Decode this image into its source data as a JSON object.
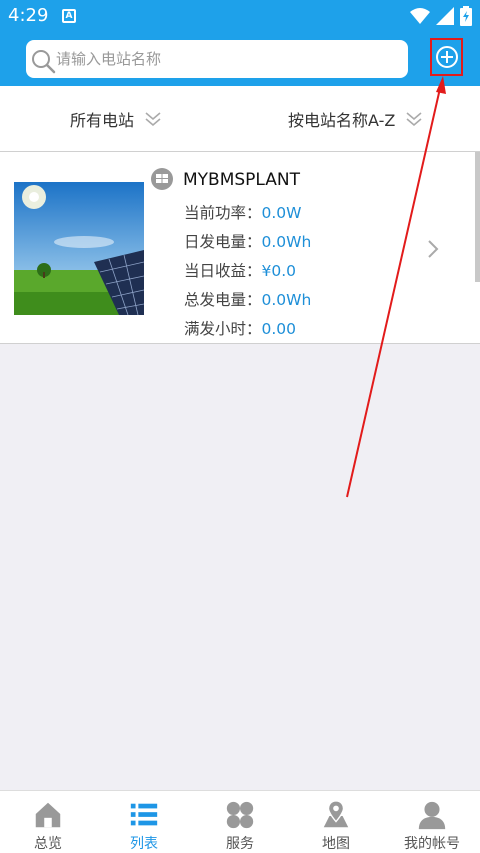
{
  "status": {
    "time": "4:29",
    "a_badge": "A"
  },
  "search": {
    "placeholder": "请输入电站名称",
    "value": ""
  },
  "filters": {
    "all_label": "所有电站",
    "sort_label": "按电站名称A-Z"
  },
  "plant": {
    "name": "MYBMSPLANT",
    "metrics": [
      {
        "label": "当前功率：",
        "value": "0.0W"
      },
      {
        "label": "日发电量：",
        "value": "0.0Wh"
      },
      {
        "label": "当日收益：",
        "value": "¥0.0"
      },
      {
        "label": "总发电量：",
        "value": "0.0Wh"
      },
      {
        "label": "满发小时：",
        "value": "0.00"
      }
    ]
  },
  "tabs": [
    {
      "label": "总览",
      "icon": "home-icon"
    },
    {
      "label": "列表",
      "icon": "list-icon",
      "active": true
    },
    {
      "label": "服务",
      "icon": "grid-icon"
    },
    {
      "label": "地图",
      "icon": "map-icon"
    },
    {
      "label": "我的帐号",
      "icon": "user-icon"
    }
  ],
  "colors": {
    "primary": "#1ea1ea",
    "accent_value": "#1e8fd8",
    "annotation": "#e21b1b"
  }
}
